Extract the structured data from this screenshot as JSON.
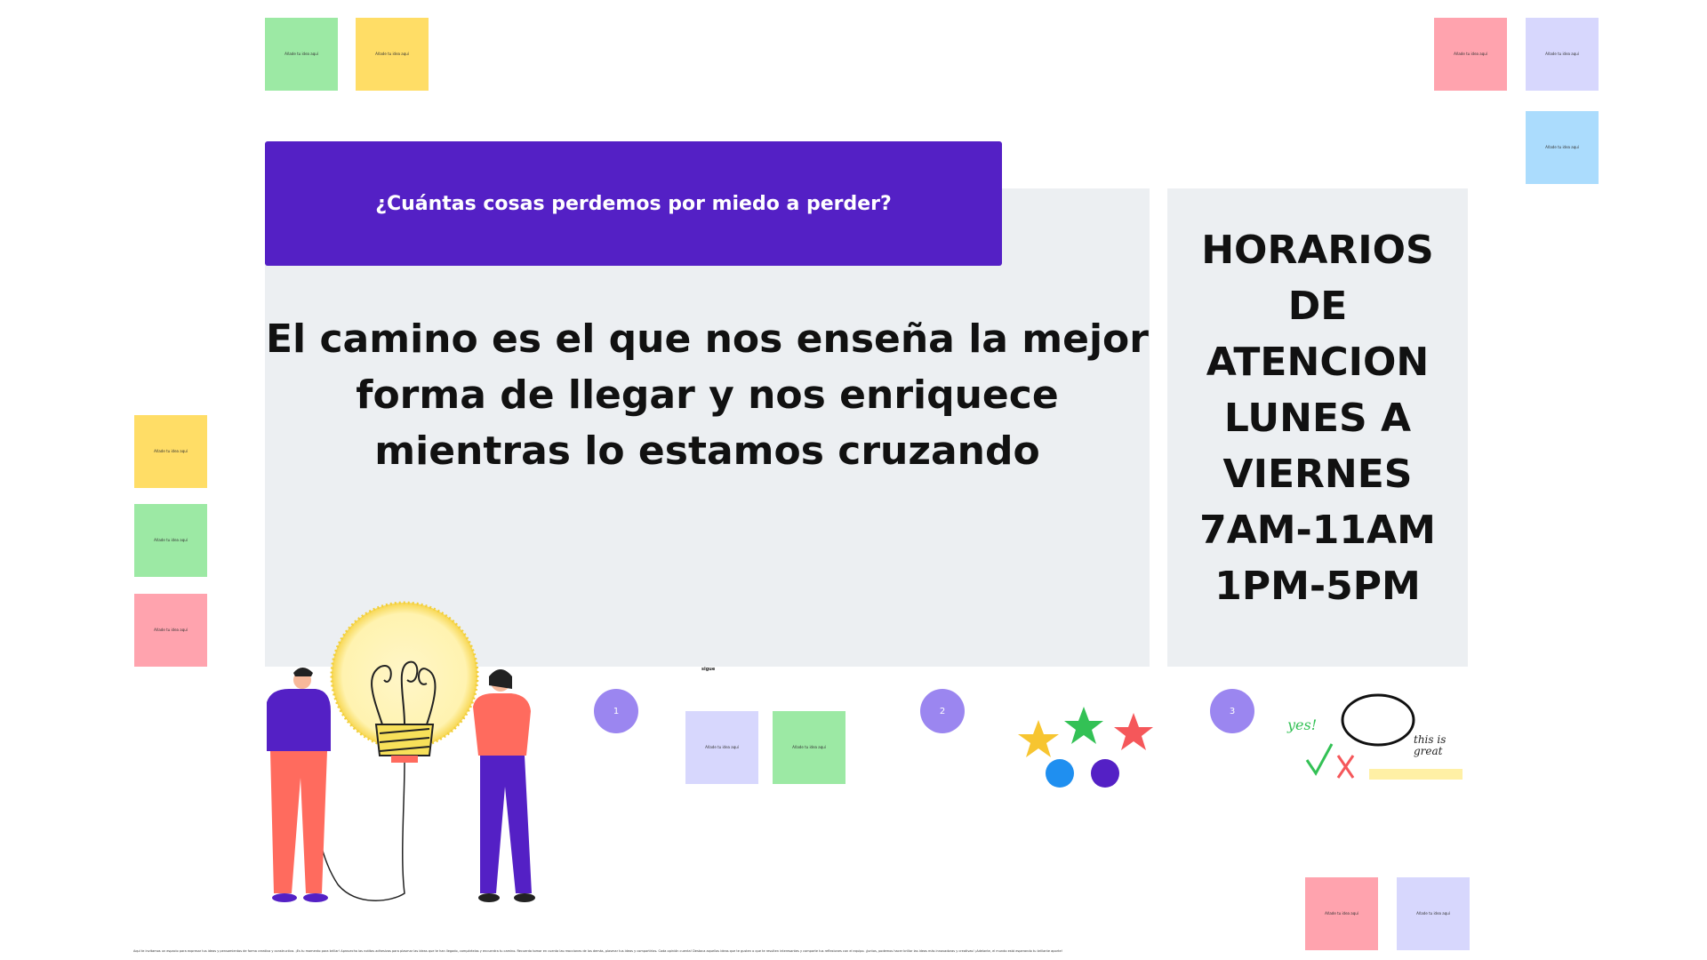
{
  "sticky_placeholder": "Añade tu idea aquí",
  "colors": {
    "green": "#9ce9a4",
    "yellow": "#ffdd66",
    "pink": "#ffa3ae",
    "lavender": "#d7d7fd",
    "blue": "#abdcfd",
    "purple_banner": "#5420c5",
    "panel_gray": "#eceff2",
    "circle_purple": "#9b86f0"
  },
  "banner": {
    "question": "¿Cuántas cosas perdemos por miedo a perder?"
  },
  "quote": {
    "text": "El camino es el que nos enseña la mejor forma de llegar y nos enriquece mientras lo estamos cruzando"
  },
  "hours": {
    "line1": "HORARIOS DE",
    "line2": "ATENCION",
    "line3": "LUNES A",
    "line4": "VIERNES",
    "line5": "7AM-11AM",
    "line6": "1PM-5PM"
  },
  "steps": {
    "one": "1",
    "two": "2",
    "three": "3"
  },
  "small_label": "sigue",
  "stickers": {
    "yes": "yes!",
    "this_is_great": "this is great"
  },
  "footer_text": "Aquí te invitamos un espacio para expresar tus ideas y pensamientos de forma creativa y constructiva. ¡Es tu momento para brillar! Aprovecha las notitas adhesivas para plasmar las ideas que te han llegado, compártelas y encuentra tu camino. Recuerda tomar en cuenta las reacciones de los demás, plasmar tus ideas y compartirlas. Cada opinión cuenta! Destaca aquellas ideas que te gusten o que te resulten interesantes y comparte tus reflexiones con el equipo. ¡Juntos, podemos hacer brillar las ideas más innovadoras y creativas! ¡Adelante, el mundo está esperando tu brillante aporte!"
}
